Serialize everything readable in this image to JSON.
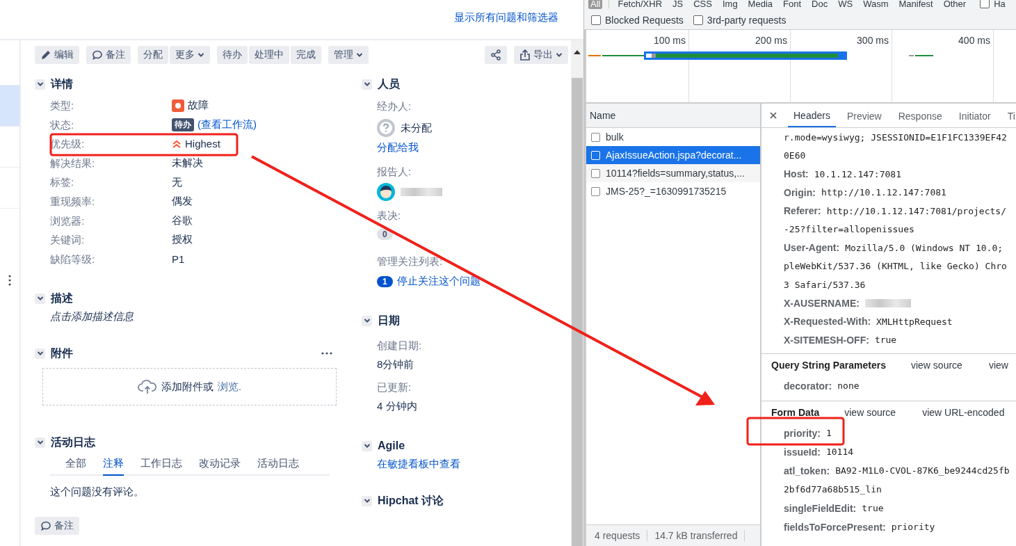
{
  "sidebar_items": [
    {
      "selected": false
    },
    {
      "selected": true
    },
    {
      "selected": false
    },
    {
      "selected": false
    }
  ],
  "issue": {
    "top_link": "显示所有问题和筛选器",
    "toolbar_left": [
      [
        {
          "label": "编辑",
          "kind": "edit",
          "dropdown": false
        }
      ],
      [
        {
          "label": "备注",
          "kind": "comment",
          "dropdown": false
        }
      ],
      [
        {
          "label": "分配",
          "kind": "plain",
          "dropdown": false
        },
        {
          "label": "更多",
          "kind": "plain",
          "dropdown": true
        }
      ],
      [
        {
          "label": "待办",
          "kind": "plain",
          "dropdown": false
        },
        {
          "label": "处理中",
          "kind": "plain",
          "dropdown": false
        },
        {
          "label": "完成",
          "kind": "plain",
          "dropdown": false
        }
      ],
      [
        {
          "label": "管理",
          "kind": "plain",
          "dropdown": true
        }
      ]
    ],
    "toolbar_right": [
      [
        {
          "kind": "share",
          "dropdown": false
        }
      ],
      [
        {
          "label": "导出",
          "kind": "export",
          "dropdown": true
        }
      ]
    ],
    "details": {
      "title": "详情",
      "fields": [
        {
          "label": "类型:",
          "value": "故障",
          "kind": "type"
        },
        {
          "label": "状态:",
          "value": "待办",
          "link": "(查看工作流)",
          "kind": "status"
        },
        {
          "label": "优先级:",
          "value": "Highest",
          "kind": "priority"
        },
        {
          "label": "解决结果:",
          "value": "未解决",
          "kind": "text"
        },
        {
          "label": "标签:",
          "value": "无",
          "kind": "text"
        },
        {
          "label": "重现频率:",
          "value": "偶发",
          "kind": "text"
        },
        {
          "label": "浏览器:",
          "value": "谷歌",
          "kind": "text"
        },
        {
          "label": "关键词:",
          "value": "授权",
          "kind": "text"
        },
        {
          "label": "缺陷等级:",
          "value": "P1",
          "kind": "text"
        }
      ]
    },
    "description": {
      "title": "描述",
      "prompt": "点击添加描述信息"
    },
    "attachments": {
      "title": "附件",
      "drop_text": "添加附件或",
      "browse_link": "浏览."
    },
    "activity": {
      "title": "活动日志",
      "tabs": [
        {
          "label": "全部",
          "selected": false
        },
        {
          "label": "注释",
          "selected": true
        },
        {
          "label": "工作日志",
          "selected": false
        },
        {
          "label": "改动记录",
          "selected": false
        },
        {
          "label": "活动日志",
          "selected": false
        }
      ],
      "empty_text": "这个问题没有评论。"
    },
    "comment_button": "备注",
    "people": {
      "title": "人员",
      "assignee_label": "经办人:",
      "assignee": "未分配",
      "assign_to_me": "分配给我",
      "reporter_label": "报告人:",
      "votes_label": "表决:",
      "votes": "0",
      "watchers_label": "管理关注列表:",
      "watchers_count": "1",
      "watch_link": "停止关注这个问题"
    },
    "dates": {
      "title": "日期",
      "items": [
        {
          "label": "创建日期:",
          "value": "8分钟前"
        },
        {
          "label": "已更新:",
          "value": "4 分钟内"
        }
      ]
    },
    "agile": {
      "title": "Agile",
      "link": "在敏捷看板中查看"
    },
    "hipchat": {
      "title": "Hipchat 讨论"
    }
  },
  "devtools": {
    "filters": [
      {
        "label": "All",
        "selected": true
      },
      {
        "label": "Fetch/XHR",
        "selected": false
      },
      {
        "label": "JS",
        "selected": false
      },
      {
        "label": "CSS",
        "selected": false
      },
      {
        "label": "Img",
        "selected": false
      },
      {
        "label": "Media",
        "selected": false
      },
      {
        "label": "Font",
        "selected": false
      },
      {
        "label": "Doc",
        "selected": false
      },
      {
        "label": "WS",
        "selected": false
      },
      {
        "label": "Wasm",
        "selected": false
      },
      {
        "label": "Manifest",
        "selected": false
      },
      {
        "label": "Other",
        "selected": false
      }
    ],
    "filter_checkbox": {
      "label": "Ha",
      "checked": false
    },
    "checkboxes": [
      {
        "label": "Blocked Requests",
        "checked": false
      },
      {
        "label": "3rd-party requests",
        "checked": false
      }
    ],
    "timeline_ticks": [
      "100 ms",
      "200 ms",
      "300 ms",
      "400 ms"
    ],
    "list_header": "Name",
    "requests": [
      {
        "name": "bulk",
        "selected": false
      },
      {
        "name": "AjaxIssueAction.jspa?decorat...",
        "selected": true
      },
      {
        "name": "10114?fields=summary,status,...",
        "selected": false
      },
      {
        "name": "JMS-25?_=1630991735215",
        "selected": false
      }
    ],
    "status": [
      "4 requests",
      "14.7 kB transferred"
    ],
    "tabs": [
      {
        "label": "Headers",
        "selected": true
      },
      {
        "label": "Preview",
        "selected": false
      },
      {
        "label": "Response",
        "selected": false
      },
      {
        "label": "Initiator",
        "selected": false
      },
      {
        "label": "Ti",
        "selected": false
      }
    ],
    "headers": [
      {
        "value": "r.mode=wysiwyg; JSESSIONID=E1F1FC1339EF42",
        "kind": "text"
      },
      {
        "value": "0E60",
        "kind": "text"
      },
      {
        "name": "Host:",
        "value": "10.1.12.147:7081",
        "kind": "text"
      },
      {
        "name": "Origin:",
        "value": "http://10.1.12.147:7081",
        "kind": "text"
      },
      {
        "name": "Referer:",
        "value": "http://10.1.12.147:7081/projects/",
        "kind": "text"
      },
      {
        "value": "-25?filter=allopenissues",
        "kind": "text"
      },
      {
        "name": "User-Agent:",
        "value": "Mozilla/5.0 (Windows NT 10.0;",
        "kind": "text"
      },
      {
        "value": "pleWebKit/537.36 (KHTML, like Gecko) Chro",
        "kind": "text"
      },
      {
        "value": "3 Safari/537.36",
        "kind": "text"
      },
      {
        "name": "X-AUSERNAME:",
        "kind": "redacted"
      },
      {
        "name": "X-Requested-With:",
        "value": "XMLHttpRequest",
        "kind": "text"
      },
      {
        "name": "X-SITEMESH-OFF:",
        "value": "true",
        "kind": "text"
      }
    ],
    "sections": [
      {
        "title": "Query String Parameters",
        "links": [
          "view source",
          "view"
        ],
        "params": [
          {
            "name": "decorator:",
            "value": "none"
          }
        ]
      },
      {
        "title": "Form Data",
        "links": [
          "view source",
          "view URL-encoded"
        ],
        "params": [
          {
            "name": "priority:",
            "value": "1"
          },
          {
            "name": "issueId:",
            "value": "10114"
          },
          {
            "name": "atl_token:",
            "value": "BA92-M1L0-CVOL-87K6_be9244cd25fb"
          },
          {
            "value": "2bf6d77a68b515_lin"
          },
          {
            "name": "singleFieldEdit:",
            "value": "true"
          },
          {
            "name": "fieldsToForcePresent:",
            "value": "priority"
          }
        ]
      }
    ]
  }
}
